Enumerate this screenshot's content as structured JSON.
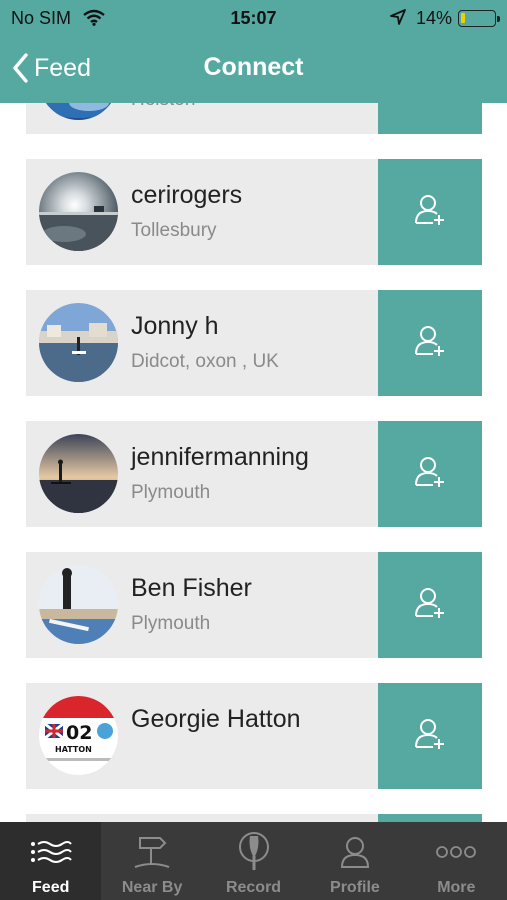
{
  "status_bar": {
    "carrier": "No SIM",
    "time": "15:07",
    "battery_percent": "14%",
    "battery_level": 0.14
  },
  "header": {
    "back_label": "Feed",
    "title": "Connect",
    "background_color": "#56a9a0"
  },
  "people": [
    {
      "name": "",
      "location": "Helston",
      "avatar": "blue-sea-photo"
    },
    {
      "name": "cerirogers",
      "location": "Tollesbury",
      "avatar": "sunset-water-photo"
    },
    {
      "name": "Jonny h",
      "location": "Didcot, oxon , UK",
      "avatar": "harbour-paddler-photo"
    },
    {
      "name": "jennifermanning",
      "location": "Plymouth",
      "avatar": "paddleboard-sunset-photo"
    },
    {
      "name": "Ben Fisher",
      "location": "Plymouth",
      "avatar": "wetsuit-paddler-photo"
    },
    {
      "name": "Georgie Hatton",
      "location": "",
      "avatar": "race-bib-02-photo",
      "bib_number": "02",
      "bib_name": "HATTON"
    }
  ],
  "follow_icon": "add-user-icon",
  "tabs": [
    {
      "label": "Feed",
      "icon": "feed-waves-icon",
      "active": true
    },
    {
      "label": "Near By",
      "icon": "signpost-icon",
      "active": false
    },
    {
      "label": "Record",
      "icon": "paddle-icon",
      "active": false
    },
    {
      "label": "Profile",
      "icon": "person-icon",
      "active": false
    },
    {
      "label": "More",
      "icon": "more-dots-icon",
      "active": false
    }
  ],
  "colors": {
    "accent": "#56a9a0",
    "card": "#ebebeb",
    "tabbar": "#3a3a3a"
  }
}
